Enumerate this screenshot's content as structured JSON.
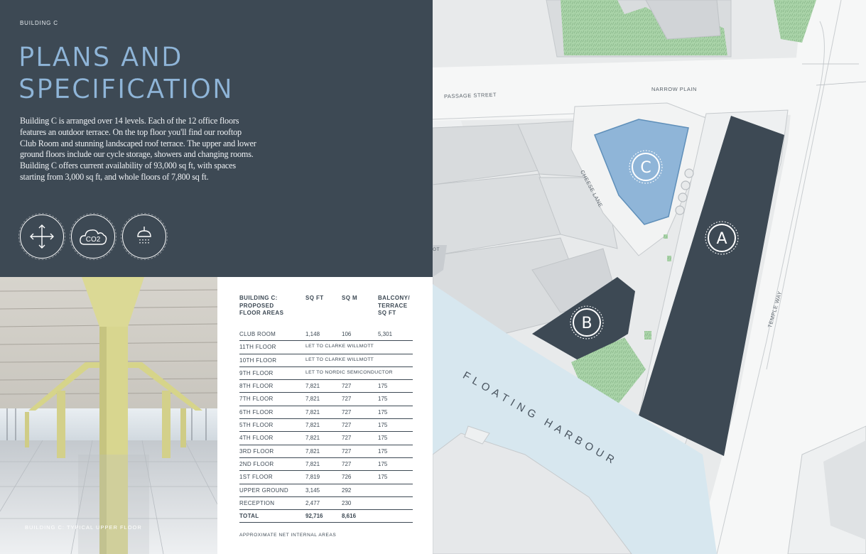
{
  "eyebrow": "BUILDING C",
  "title_line1": "PLANS AND",
  "title_line2": "SPECIFICATION",
  "intro": "Building C is arranged over 14 levels. Each of the 12 office floors features an outdoor terrace. On the top floor you'll find our rooftop Club Room and stunning landscaped roof terrace. The upper and lower ground floors include our cycle storage, showers and changing rooms. Building C offers current availability of 93,000 sq ft, with spaces starting from 3,000 sq ft, and whole floors of 7,800 sq ft.",
  "icons": [
    "expand-arrows-icon",
    "co2-cloud-icon",
    "shower-icon"
  ],
  "icon_co2_text": "CO2",
  "photo_caption": "BUILDING C: TYPICAL UPPER FLOOR",
  "table": {
    "headers": [
      "BUILDING C: PROPOSED FLOOR AREAS",
      "SQ FT",
      "SQ M",
      "BALCONY/ TERRACE SQ FT"
    ],
    "rows": [
      {
        "floor": "CLUB ROOM",
        "sqft": "1,148",
        "sqm": "106",
        "terrace": "5,301"
      },
      {
        "floor": "11TH FLOOR",
        "note": "LET TO CLARKE WILLMOTT"
      },
      {
        "floor": "10TH FLOOR",
        "note": "LET TO CLARKE WILLMOTT"
      },
      {
        "floor": "9TH FLOOR",
        "note": "LET TO NORDIC SEMICONDUCTOR"
      },
      {
        "floor": "8TH FLOOR",
        "sqft": "7,821",
        "sqm": "727",
        "terrace": "175"
      },
      {
        "floor": "7TH FLOOR",
        "sqft": "7,821",
        "sqm": "727",
        "terrace": "175"
      },
      {
        "floor": "6TH FLOOR",
        "sqft": "7,821",
        "sqm": "727",
        "terrace": "175"
      },
      {
        "floor": "5TH FLOOR",
        "sqft": "7,821",
        "sqm": "727",
        "terrace": "175"
      },
      {
        "floor": "4TH FLOOR",
        "sqft": "7,821",
        "sqm": "727",
        "terrace": "175"
      },
      {
        "floor": "3RD FLOOR",
        "sqft": "7,821",
        "sqm": "727",
        "terrace": "175"
      },
      {
        "floor": "2ND FLOOR",
        "sqft": "7,821",
        "sqm": "727",
        "terrace": "175"
      },
      {
        "floor": "1ST FLOOR",
        "sqft": "7,819",
        "sqm": "726",
        "terrace": "175"
      },
      {
        "floor": "UPPER GROUND",
        "sqft": "3,145",
        "sqm": "292",
        "terrace": ""
      },
      {
        "floor": "RECEPTION",
        "sqft": "2,477",
        "sqm": "230",
        "terrace": ""
      },
      {
        "floor": "TOTAL",
        "sqft": "92,716",
        "sqm": "8,616",
        "terrace": "",
        "total": true
      }
    ],
    "footnote": "APPROXIMATE NET INTERNAL AREAS"
  },
  "map": {
    "streets": {
      "passage": "PASSAGE STREET",
      "narrow": "NARROW PLAIN",
      "cheese": "CHEESE LANE",
      "temple": "TEMPLE WAY"
    },
    "harbour": "FLOATING HARBOUR",
    "buildings": {
      "a": "A",
      "b": "B",
      "c": "C"
    },
    "fragment": "OT"
  },
  "colors": {
    "panel": "#3d4954",
    "title": "#8fb5d8",
    "building_c": "#8fb5d8",
    "water": "#d7e7ef",
    "green": "#a9d3a8"
  }
}
